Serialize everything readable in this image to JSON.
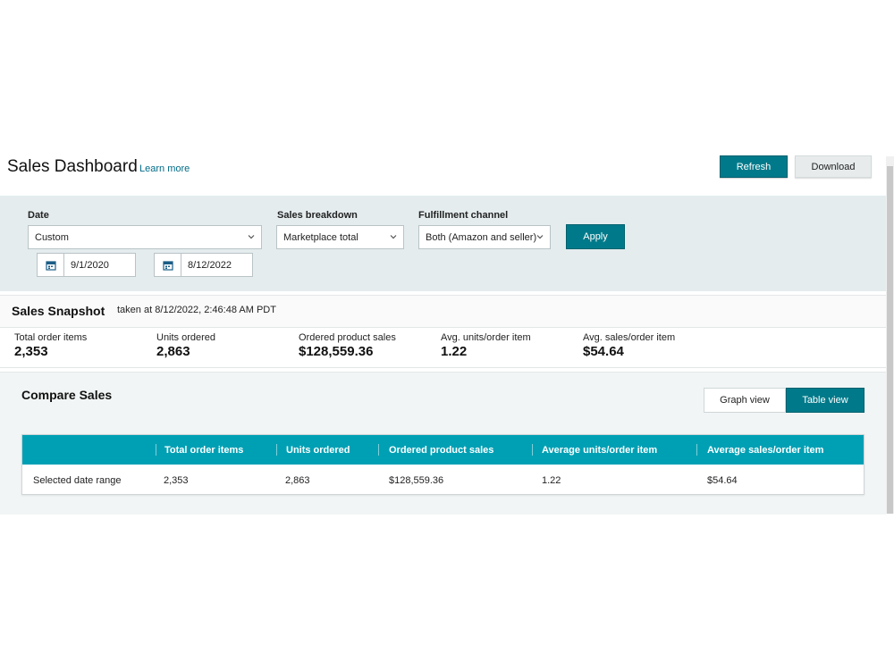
{
  "header": {
    "title": "Sales Dashboard",
    "learn_more": "Learn more",
    "refresh_label": "Refresh",
    "download_label": "Download"
  },
  "filters": {
    "date_label": "Date",
    "date_range_value": "Custom",
    "start_date": "9/1/2020",
    "end_date": "8/12/2022",
    "breakdown_label": "Sales breakdown",
    "breakdown_value": "Marketplace total",
    "channel_label": "Fulfillment channel",
    "channel_value": "Both (Amazon and seller)",
    "apply_label": "Apply"
  },
  "snapshot": {
    "title": "Sales Snapshot",
    "taken": "taken at 8/12/2022, 2:46:48 AM PDT",
    "metrics": [
      {
        "label": "Total order items",
        "value": "2,353"
      },
      {
        "label": "Units ordered",
        "value": "2,863"
      },
      {
        "label": "Ordered product sales",
        "value": "$128,559.36"
      },
      {
        "label": "Avg. units/order item",
        "value": "1.22"
      },
      {
        "label": "Avg. sales/order item",
        "value": "$54.64"
      }
    ]
  },
  "compare": {
    "title": "Compare Sales",
    "graph_view_label": "Graph view",
    "table_view_label": "Table view",
    "columns": [
      "",
      "Total order items",
      "Units ordered",
      "Ordered product sales",
      "Average units/order item",
      "Average sales/order item"
    ],
    "rows": [
      [
        "Selected date range",
        "2,353",
        "2,863",
        "$128,559.36",
        "1.22",
        "$54.64"
      ]
    ]
  },
  "icons": {
    "calendar": "calendar-icon",
    "chevron": "chevron-down-icon"
  },
  "colors": {
    "accent": "#007a8a",
    "table_header": "#00a0b4",
    "filter_band": "#e4ecee"
  }
}
